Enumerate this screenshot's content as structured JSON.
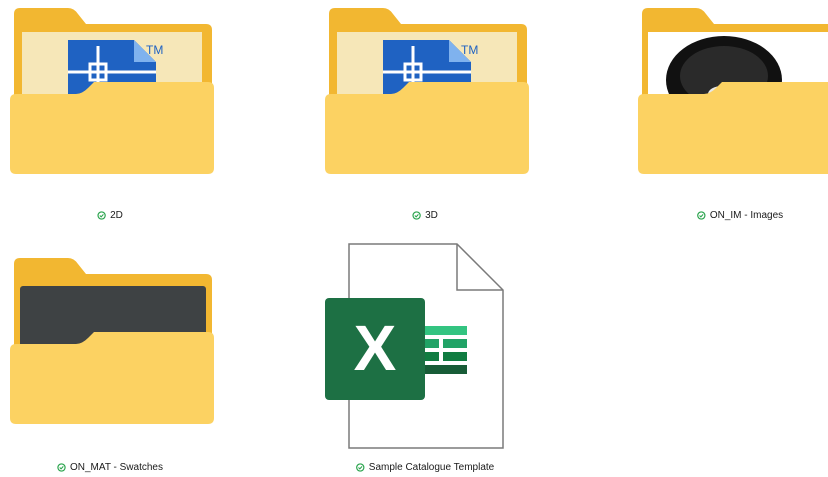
{
  "items": [
    {
      "name": "2D",
      "type": "folder",
      "preview": "cad-icon",
      "badge": "TM",
      "status": "synced-icon"
    },
    {
      "name": "3D",
      "type": "folder",
      "preview": "cad-icon",
      "badge": "TM",
      "status": "synced-icon"
    },
    {
      "name": "ON_IM - Images",
      "type": "folder",
      "preview": "photo-thumbnail",
      "status": "synced-icon"
    },
    {
      "name": "ON_MAT - Swatches",
      "type": "folder",
      "preview": "swatch-thumbnail",
      "status": "synced-icon"
    },
    {
      "name": "Sample Catalogue Template",
      "type": "excel-file",
      "preview": "excel-icon",
      "badge": "X",
      "status": "synced-icon"
    }
  ],
  "colors": {
    "folder_back": "#f2b731",
    "folder_front": "#fcd262",
    "cad_blue": "#1f62c2",
    "excel_green": "#1d7044",
    "sync_green": "#2aa44d"
  }
}
